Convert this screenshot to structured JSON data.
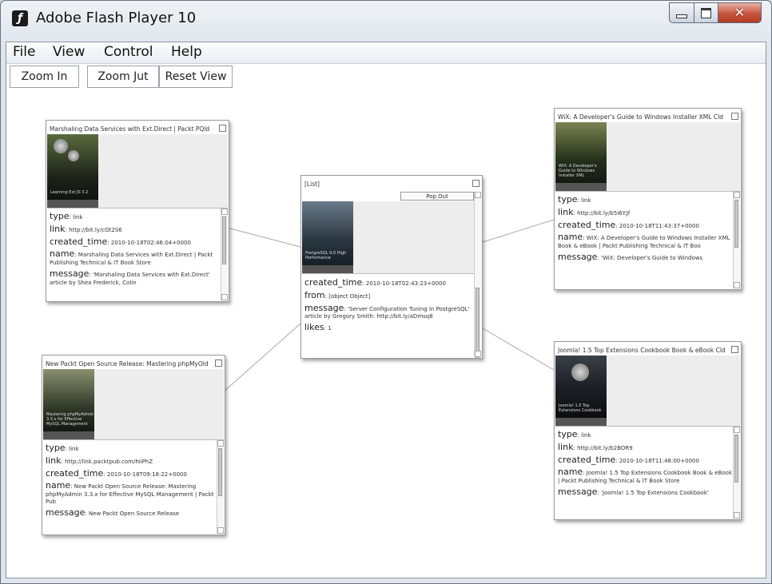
{
  "window": {
    "title": "Adobe Flash Player 10"
  },
  "menu": [
    "File",
    "View",
    "Control",
    "Help"
  ],
  "toolbar": {
    "zoom_in": "Zoom In",
    "zoom_out": "Zoom Jut",
    "reset": "Reset View"
  },
  "center": {
    "title": "[List]",
    "pop_out": "Pop Out",
    "fields": [
      {
        "label": "created_time",
        "value": "2010-10-18T02:43:23+0000"
      },
      {
        "label": "from",
        "value": "[object Object]"
      },
      {
        "label": "message",
        "value": "'Server Configuration Tuning in PostgreSQL' article by Gregory Smith: http://bit.ly/aDmsq8"
      },
      {
        "label": "likes",
        "value": "1"
      }
    ]
  },
  "cards": [
    {
      "title": "Marshaling Data Services with Ext.Direct | Packt PQld",
      "fields": [
        {
          "label": "type",
          "value": "link"
        },
        {
          "label": "link",
          "value": "http://bit.ly/cOt2S6"
        },
        {
          "label": "created_time",
          "value": "2010-10-18T02:46:04+0000"
        },
        {
          "label": "name",
          "value": "Marshaling Data Services with Ext.Direct | Packt Publishing Technical & IT Book Store"
        },
        {
          "label": "message",
          "value": "'Marshaling Data Services with Ext.Direct' article by Shea Frederick, Colin"
        }
      ]
    },
    {
      "title": "WiX: A Developer's Guide to Windows Installer XML Cld",
      "fields": [
        {
          "label": "type",
          "value": "link"
        },
        {
          "label": "link",
          "value": "http://bit.ly/b5i6Y.Jf"
        },
        {
          "label": "created_time",
          "value": "2010-10-18T11:43:37+0000"
        },
        {
          "label": "name",
          "value": "WiX: A Developer's Guide to Windows Installer XML Book & eBook | Packt Publishing Technical & IT Boo"
        },
        {
          "label": "message",
          "value": "'WiX: Developer's Guide to Windows"
        }
      ]
    },
    {
      "title": "New Packt Open Source Release: Mastering phpMyOld",
      "fields": [
        {
          "label": "type",
          "value": "link"
        },
        {
          "label": "link",
          "value": "http://link.packtpub.com/hiiPhZ"
        },
        {
          "label": "created_time",
          "value": "2010-10-18T09:18:22+0000"
        },
        {
          "label": "name",
          "value": "New Packt Open Source Release: Mastering phpMyAdmin 3.3.x for Effective MySQL Management | Packt Pub"
        },
        {
          "label": "message",
          "value": "New Packt Open Source Release"
        }
      ]
    },
    {
      "title": "Joomla! 1.5 Top Extensions Cookbook Book & eBook Cld",
      "fields": [
        {
          "label": "type",
          "value": "link"
        },
        {
          "label": "link",
          "value": "http://bit.ly/b2BOR9"
        },
        {
          "label": "created_time",
          "value": "2010-10-18T11:48:00+0000"
        },
        {
          "label": "name",
          "value": "Joomla! 1.5 Top Extensions Cookbook Book & eBook | Packt Publishing Technical & IT Book Store"
        },
        {
          "label": "message",
          "value": "'Joomla! 1.5 Top Extensions Cookbook'"
        }
      ]
    }
  ]
}
